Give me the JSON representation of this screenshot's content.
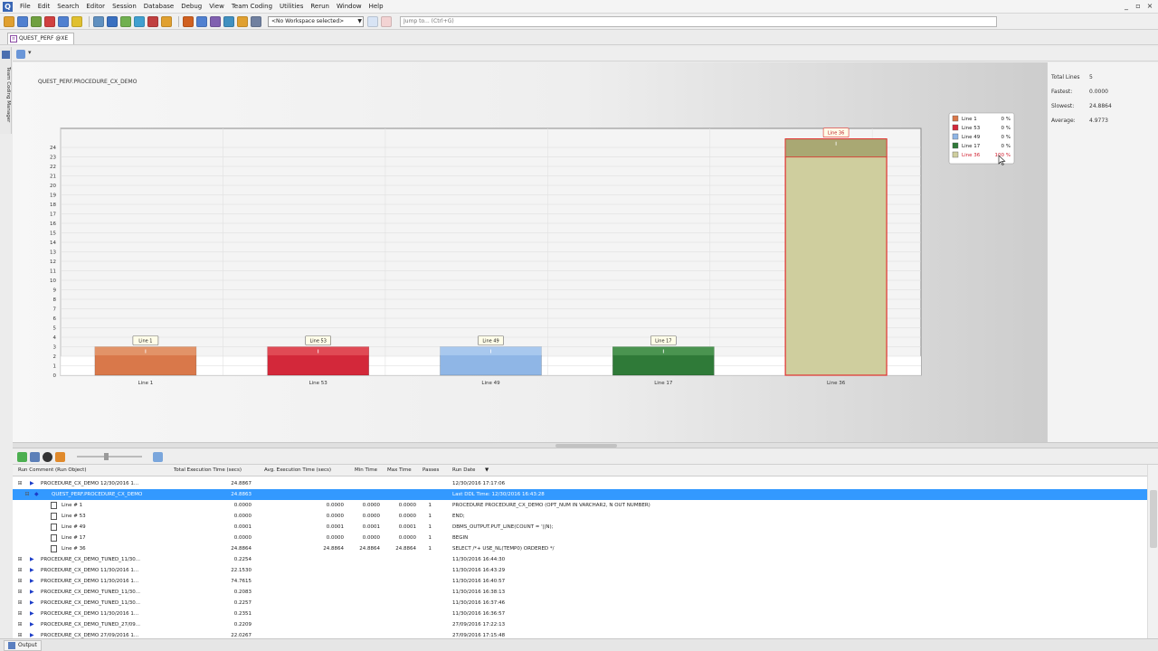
{
  "menus": [
    "File",
    "Edit",
    "Search",
    "Editor",
    "Session",
    "Database",
    "Debug",
    "View",
    "Team Coding",
    "Utilities",
    "Rerun",
    "Window",
    "Help"
  ],
  "window_controls": [
    "_",
    "▫",
    "×"
  ],
  "toolbar": {
    "workspace_select": "<No Workspace selected>",
    "jump_placeholder": "Jump to... (Ctrl+G)",
    "icon_colors": [
      "#e0a030",
      "#5080d0",
      "#70a040",
      "#d04040",
      "#5080d0",
      "#e0c030",
      "#6090c0",
      "#3a70c0",
      "#70b050",
      "#40a0d0",
      "#c04040",
      "#e0a030",
      "#d06020",
      "#5080d0",
      "#8060b0",
      "#4090c0",
      "#e0a030",
      "#7080a0"
    ]
  },
  "doctab": {
    "label": "QUEST_PERF @XE"
  },
  "side_strip": {
    "label": "Team Coding Manager"
  },
  "chart": {
    "title": "QUEST_PERF.PROCEDURE_CX_DEMO",
    "legend_selected_index": 4,
    "bar_colors": [
      "#d9784a",
      "#d3283a",
      "#8fb6e6",
      "#2f7a38",
      "#cfce9e"
    ],
    "bar_tops": [
      "#e29368",
      "#e04a55",
      "#a8c8ee",
      "#4a9450",
      "#a9a873"
    ]
  },
  "chart_data": {
    "type": "bar",
    "categories": [
      "Line 1",
      "Line 53",
      "Line 49",
      "Line 17",
      "Line 36"
    ],
    "values": [
      0.0,
      0.0,
      0.0001,
      0.0,
      24.8864
    ],
    "bar_labels": [
      "Line 1",
      "Line 53",
      "Line 49",
      "Line 17",
      "Line 36"
    ],
    "legend": [
      {
        "name": "Line 1",
        "pct": "0 %"
      },
      {
        "name": "Line 53",
        "pct": "0 %"
      },
      {
        "name": "Line 49",
        "pct": "0 %"
      },
      {
        "name": "Line 17",
        "pct": "0 %"
      },
      {
        "name": "Line 36",
        "pct": "100 %"
      }
    ],
    "ylim": [
      0,
      26
    ],
    "yticks": [
      0,
      1,
      2,
      3,
      4,
      5,
      6,
      7,
      8,
      9,
      10,
      11,
      12,
      13,
      14,
      15,
      16,
      17,
      18,
      19,
      20,
      21,
      22,
      23,
      24
    ],
    "grid": true,
    "legend_placement": "top-right"
  },
  "stats": [
    {
      "label": "Total Lines",
      "value": "5"
    },
    {
      "label": "Fastest:",
      "value": "0.0000"
    },
    {
      "label": "Slowest:",
      "value": "24.8864"
    },
    {
      "label": "Average:",
      "value": "4.9773"
    }
  ],
  "grid": {
    "headers": [
      "Run Comment (Run Object)",
      "Total Execution Time (secs)",
      "Avg. Execution Time (secs)",
      "Min Time",
      "Max Time",
      "Passes",
      "Run Date"
    ],
    "sort_indicator": "▼",
    "rows": [
      {
        "kind": "run",
        "expanded": false,
        "name": "PROCEDURE_CX_DEMO 12/30/2016 1...",
        "total": "24.8867",
        "avg": "",
        "min": "",
        "max": "",
        "passes": "",
        "date": "12/30/2016 17:17:06"
      },
      {
        "kind": "object",
        "expanded": true,
        "selected": true,
        "name": "QUEST_PERF.PROCEDURE_CX_DEMO",
        "total": "24.8863",
        "avg": "",
        "min": "",
        "max": "",
        "passes": "",
        "date": "Last DDL Time: 12/30/2016 16:43:28"
      },
      {
        "kind": "line",
        "name": "Line # 1",
        "total": "0.0000",
        "avg": "0.0000",
        "min": "0.0000",
        "max": "0.0000",
        "passes": "1",
        "date": "PROCEDURE        PROCEDURE_CX_DEMO (OPT_NUM IN VARCHAR2, N OUT NUMBER)"
      },
      {
        "kind": "line",
        "name": "Line # 53",
        "total": "0.0000",
        "avg": "0.0000",
        "min": "0.0000",
        "max": "0.0000",
        "passes": "1",
        "date": "END;"
      },
      {
        "kind": "line",
        "name": "Line # 49",
        "total": "0.0001",
        "avg": "0.0001",
        "min": "0.0001",
        "max": "0.0001",
        "passes": "1",
        "date": "DBMS_OUTPUT.PUT_LINE(COUNT = '||N);"
      },
      {
        "kind": "line",
        "name": "Line # 17",
        "total": "0.0000",
        "avg": "0.0000",
        "min": "0.0000",
        "max": "0.0000",
        "passes": "1",
        "date": "BEGIN"
      },
      {
        "kind": "line",
        "name": "Line # 36",
        "total": "24.8864",
        "avg": "24.8864",
        "min": "24.8864",
        "max": "24.8864",
        "passes": "1",
        "date": "SELECT /*+ USE_NL(TEMP0) ORDERED */"
      },
      {
        "kind": "run",
        "expanded": false,
        "name": "PROCEDURE_CX_DEMO_TUNED_11/30...",
        "total": "0.2254",
        "avg": "",
        "min": "",
        "max": "",
        "passes": "",
        "date": "11/30/2016 16:44:30"
      },
      {
        "kind": "run",
        "expanded": false,
        "name": "PROCEDURE_CX_DEMO 11/30/2016 1...",
        "total": "22.1530",
        "avg": "",
        "min": "",
        "max": "",
        "passes": "",
        "date": "11/30/2016 16:43:29"
      },
      {
        "kind": "run",
        "expanded": false,
        "name": "PROCEDURE_CX_DEMO 11/30/2016 1...",
        "total": "74.7615",
        "avg": "",
        "min": "",
        "max": "",
        "passes": "",
        "date": "11/30/2016 16:40:57"
      },
      {
        "kind": "run",
        "expanded": false,
        "name": "PROCEDURE_CX_DEMO_TUNED_11/30...",
        "total": "0.2083",
        "avg": "",
        "min": "",
        "max": "",
        "passes": "",
        "date": "11/30/2016 16:38:13"
      },
      {
        "kind": "run",
        "expanded": false,
        "name": "PROCEDURE_CX_DEMO_TUNED_11/30...",
        "total": "0.2257",
        "avg": "",
        "min": "",
        "max": "",
        "passes": "",
        "date": "11/30/2016 16:37:46"
      },
      {
        "kind": "run",
        "expanded": false,
        "name": "PROCEDURE_CX_DEMO 11/30/2016 1...",
        "total": "0.2351",
        "avg": "",
        "min": "",
        "max": "",
        "passes": "",
        "date": "11/30/2016 16:36:57"
      },
      {
        "kind": "run",
        "expanded": false,
        "name": "PROCEDURE_CX_DEMO_TUNED_27/09...",
        "total": "0.2209",
        "avg": "",
        "min": "",
        "max": "",
        "passes": "",
        "date": "27/09/2016 17:22:13"
      },
      {
        "kind": "run",
        "expanded": false,
        "name": "PROCEDURE_CX_DEMO 27/09/2016 1...",
        "total": "22.0267",
        "avg": "",
        "min": "",
        "max": "",
        "passes": "",
        "date": "27/09/2016 17:15:48"
      }
    ]
  },
  "bottom": {
    "output_label": "Output"
  }
}
